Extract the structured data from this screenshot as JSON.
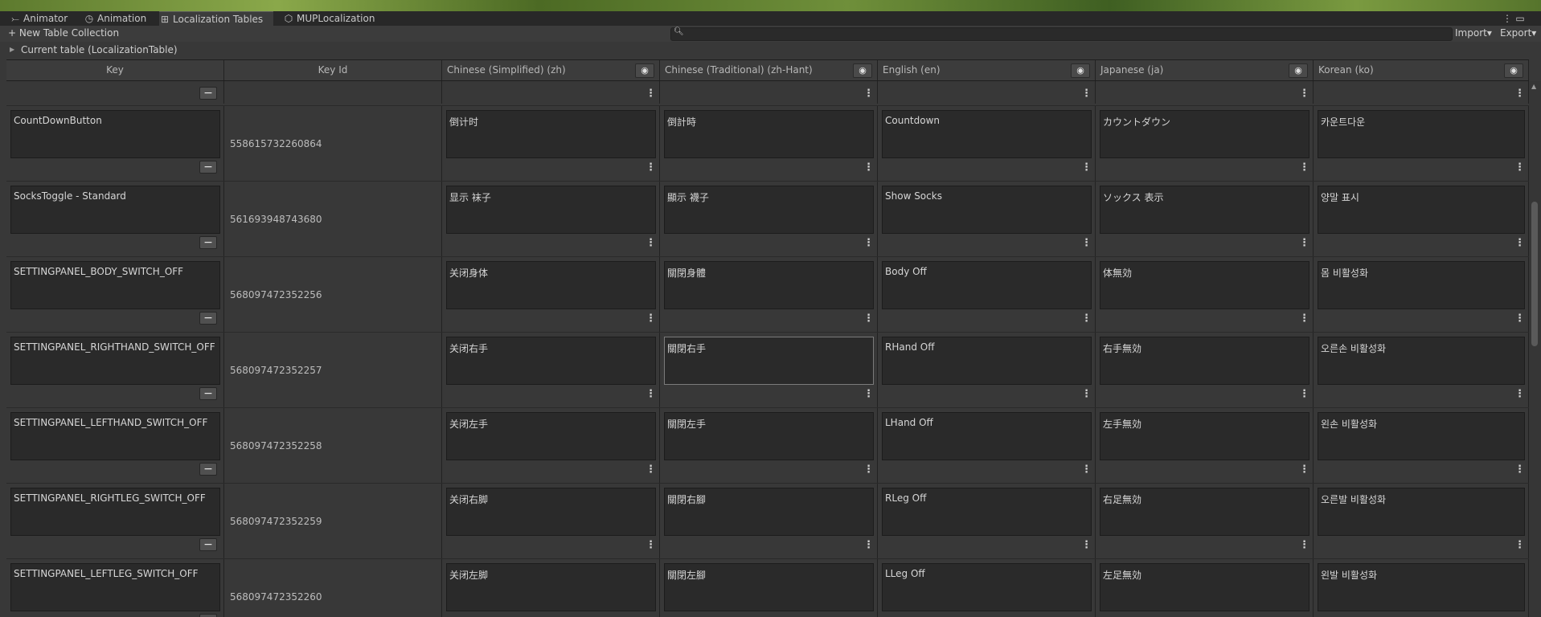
{
  "tabs": [
    {
      "label": "Animator",
      "icon": "animator-icon",
      "glyph": "⤚"
    },
    {
      "label": "Animation",
      "icon": "animation-clock-icon",
      "glyph": "◷"
    },
    {
      "label": "Localization Tables",
      "icon": "localization-tables-icon",
      "glyph": "⊞"
    },
    {
      "label": "MUPLocalization",
      "icon": "cube-icon",
      "glyph": "⬡"
    }
  ],
  "window_buttons": {
    "menu": "⋮",
    "maximize": "▭"
  },
  "toolbar": {
    "new_table_label": "+ New Table Collection",
    "search_value": "",
    "import_label": "Import▾",
    "export_label": "Export▾"
  },
  "current_table_label": "Current table (LocalizationTable)",
  "columns": {
    "key": "Key",
    "key_id": "Key Id",
    "zh": "Chinese (Simplified) (zh)",
    "zh_hant": "Chinese (Traditional) (zh-Hant)",
    "en": "English (en)",
    "ja": "Japanese (ja)",
    "ko": "Korean (ko)"
  },
  "rows": [
    {
      "key": "CountDownButton",
      "id": "558615732260864",
      "zh": "倒计时",
      "zh_hant": "倒計時",
      "en": "Countdown",
      "ja": "カウントダウン",
      "ko": "카운트다운"
    },
    {
      "key": "SocksToggle - Standard",
      "id": "561693948743680",
      "zh": "显示 袜子",
      "zh_hant": "顯示 襪子",
      "en": "Show Socks",
      "ja": "ソックス  表示",
      "ko": "양말 표시"
    },
    {
      "key": "SETTINGPANEL_BODY_SWITCH_OFF",
      "id": "568097472352256",
      "zh": "关闭身体",
      "zh_hant": "關閉身體",
      "en": "Body Off",
      "ja": "体無効",
      "ko": "몸 비활성화"
    },
    {
      "key": "SETTINGPANEL_RIGHTHAND_SWITCH_OFF",
      "id": "568097472352257",
      "zh": "关闭右手",
      "zh_hant": "關閉右手",
      "en": "RHand Off",
      "ja": "右手無効",
      "ko": "오른손 비활성화"
    },
    {
      "key": "SETTINGPANEL_LEFTHAND_SWITCH_OFF",
      "id": "568097472352258",
      "zh": "关闭左手",
      "zh_hant": "關閉左手",
      "en": "LHand Off",
      "ja": "左手無効",
      "ko": "왼손 비활성화"
    },
    {
      "key": "SETTINGPANEL_RIGHTLEG_SWITCH_OFF",
      "id": "568097472352259",
      "zh": "关闭右脚",
      "zh_hant": "關閉右腳",
      "en": "RLeg Off",
      "ja": "右足無効",
      "ko": "오른발 비활성화"
    },
    {
      "key": "SETTINGPANEL_LEFTLEG_SWITCH_OFF",
      "id": "568097472352260",
      "zh": "关闭左脚",
      "zh_hant": "關閉左腳",
      "en": "LLeg Off",
      "ja": "左足無効",
      "ko": "왼발 비활성화"
    }
  ],
  "colors": {
    "background": "#383838",
    "field": "#2a2a2a",
    "tabbar": "#282828"
  }
}
